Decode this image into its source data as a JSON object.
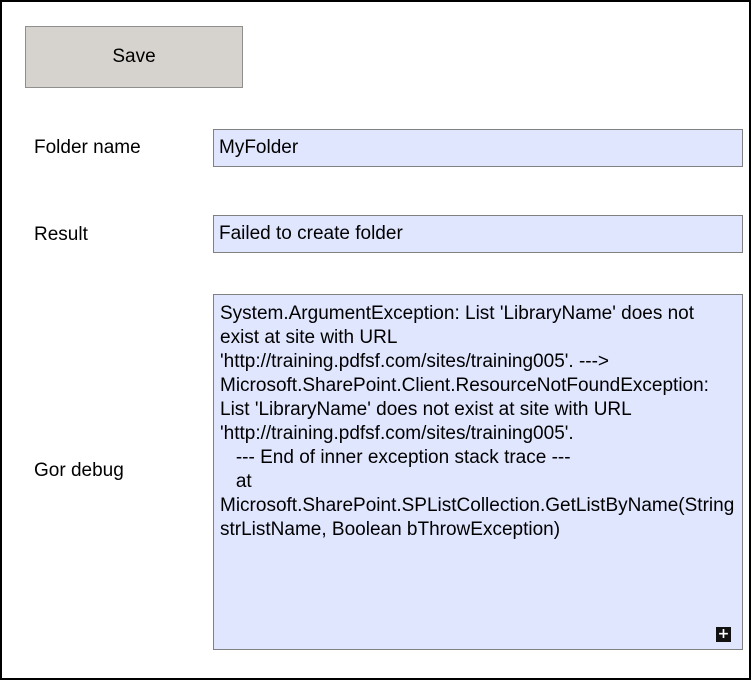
{
  "toolbar": {
    "save_label": "Save"
  },
  "form": {
    "folder_name": {
      "label": "Folder name",
      "value": "MyFolder"
    },
    "result": {
      "label": "Result",
      "value": "Failed to create folder"
    },
    "debug": {
      "label": "Gor debug",
      "value": "System.ArgumentException: List 'LibraryName' does not exist at site with URL 'http://training.pdfsf.com/sites/training005'. ---> Microsoft.SharePoint.Client.ResourceNotFoundException: List 'LibraryName' does not exist at site with URL 'http://training.pdfsf.com/sites/training005'.\n   --- End of inner exception stack trace ---\n   at Microsoft.SharePoint.SPListCollection.GetListByName(String strListName, Boolean bThrowException)",
      "expand_icon": "plus-icon",
      "expand_glyph": "+"
    }
  },
  "colors": {
    "field_background": "#e1e6ff",
    "button_background": "#d6d3ce",
    "border": "#000000"
  }
}
